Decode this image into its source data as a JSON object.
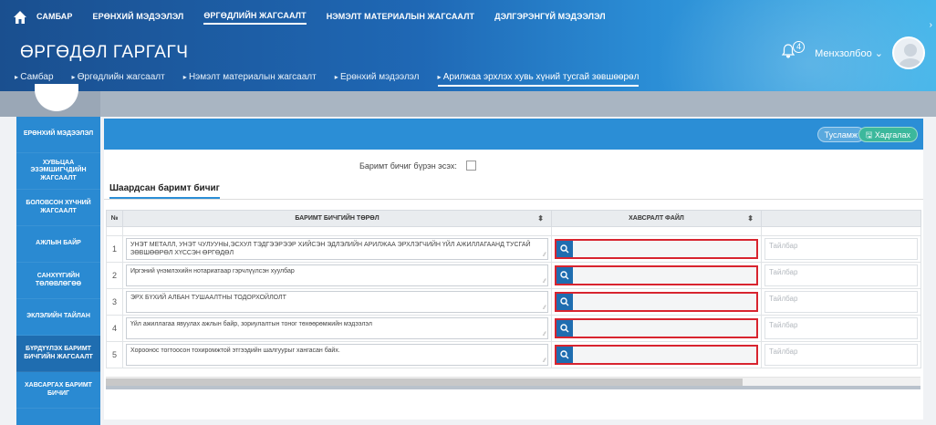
{
  "topnav": {
    "items": [
      "САМБАР",
      "ЕРӨНХИЙ МЭДЭЭЛЭЛ",
      "ӨРГӨДЛИЙН ЖАГСААЛТ",
      "НЭМЭЛТ МАТЕРИАЛЫН ЖАГСААЛТ",
      "ДЭЛГЭРЭНГҮЙ МЭДЭЭЛЭЛ"
    ]
  },
  "header": {
    "title": "ӨРГӨДӨЛ ГАРГАГЧ",
    "username": "Менхзолбоо",
    "notifications": "4"
  },
  "breadcrumb": [
    "Самбар",
    "Өргөдлийн жагсаалт",
    "Нэмэлт материалын жагсаалт",
    "Ерөнхий мэдээлэл",
    "Арилжаа эрхлэх хувь хүний тусгай зөвшөөрөл"
  ],
  "sidebar": {
    "items": [
      "ЕРӨНХИЙ МЭДЭЭЛЭЛ",
      "ХУВЬЦАА ЭЗЭМШИГЧДИЙН ЖАГСААЛТ",
      "БОЛОВСОН ХҮЧНИЙ ЖАГСААЛТ",
      "АЖЛЫН БАЙР",
      "САНХҮҮГИЙН ТӨЛӨВЛӨГӨӨ",
      "ЭКЛЭЛИЙН ТАЙЛАН",
      "БҮРДҮҮЛЭХ БАРИМТ БИЧГИЙН ЖАГСААЛТ",
      "ХАВСАРГАХ БАРИМТ БИЧИГ"
    ]
  },
  "panel": {
    "help_label": "Тусламж",
    "save_label": "Хадгалах",
    "check_label": "Баримт бичиг бүрэн эсэх:",
    "subtab": "Шаардсан баримт бичиг"
  },
  "table": {
    "headers": [
      "№",
      "БАРИМТ БИЧГИЙН ТӨРӨЛ",
      "ХАВСРАЛТ ФАЙЛ",
      ""
    ],
    "note_placeholder": "Тайлбар",
    "rows": [
      {
        "n": "1",
        "doc": "УНЭТ МЕТАЛЛ, УНЭТ ЧУЛУУНЫ,ЭСХУЛ ТЭДГЭЭРЭЭР ХИЙСЭН ЭДЛЭЛИЙН АРИЛЖАА ЭРХЛЭГЧИЙН ҮЙЛ АЖИЛЛАГААНД ТУСГАЙ ЗӨВШӨӨРӨЛ ХҮССЭН ӨРГӨДӨЛ"
      },
      {
        "n": "2",
        "doc": "Иргэний үнэмлэхийн нотариатаар гэрчлүүлсэн хуулбар"
      },
      {
        "n": "3",
        "doc": "ЭРХ БҮХИЙ АЛБАН ТУШААЛТНЫ ТОДОРХОЙЛОЛТ"
      },
      {
        "n": "4",
        "doc": "Үйл ажиллагаа явуулах ажлын байр, зориулалтын тоног төхөөрөмжийн мэдээлэл"
      },
      {
        "n": "5",
        "doc": "Хороонос тогтоосон тохиромжтой этгээдийн шалгуурыг хангасан байх."
      }
    ]
  }
}
